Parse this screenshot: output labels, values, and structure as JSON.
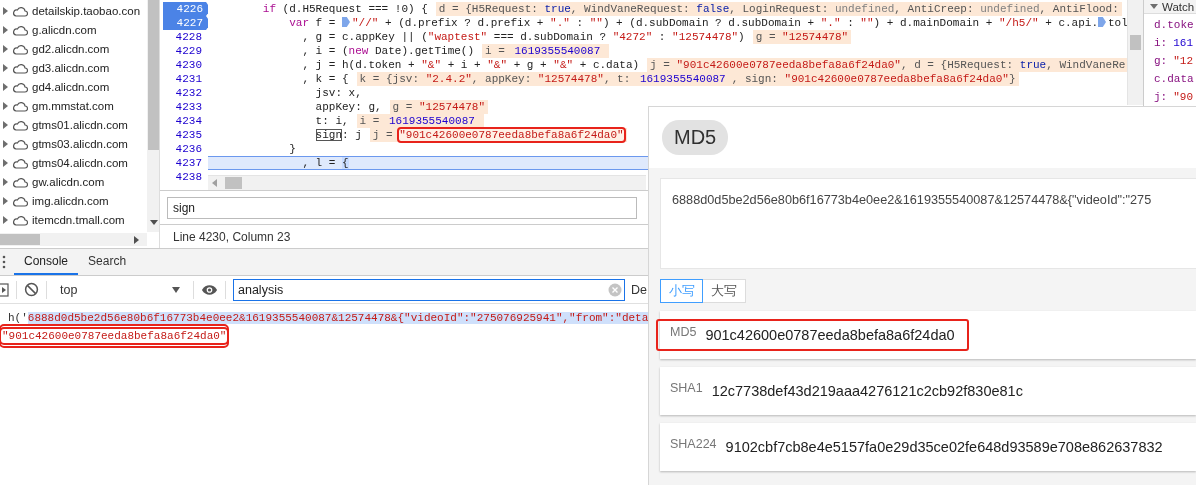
{
  "sidebar": {
    "items": [
      {
        "label": "detailskip.taobao.con",
        "expanded": false
      },
      {
        "label": "g.alicdn.com",
        "expanded": false
      },
      {
        "label": "gd2.alicdn.com",
        "expanded": false
      },
      {
        "label": "gd3.alicdn.com",
        "expanded": false
      },
      {
        "label": "gd4.alicdn.com",
        "expanded": false
      },
      {
        "label": "gm.mmstat.com",
        "expanded": false
      },
      {
        "label": "gtms01.alicdn.com",
        "expanded": false
      },
      {
        "label": "gtms03.alicdn.com",
        "expanded": false
      },
      {
        "label": "gtms04.alicdn.com",
        "expanded": false
      },
      {
        "label": "gw.alicdn.com",
        "expanded": false
      },
      {
        "label": "img.alicdn.com",
        "expanded": false
      },
      {
        "label": "itemcdn.tmall.com",
        "expanded": false
      }
    ]
  },
  "editor": {
    "lines": [
      {
        "number": "4226",
        "breakpoint": true,
        "current": false,
        "code": [
          {
            "text": "if",
            "kind": "kw"
          },
          {
            "text": " (d.H5Request === !0) {",
            "kind": "plain"
          }
        ],
        "inline": [
          {
            "text": "d = {H5Request: ",
            "kind": "plain"
          },
          {
            "text": "true",
            "kind": "bool"
          },
          {
            "text": ", WindVaneRequest: ",
            "kind": "plain"
          },
          {
            "text": "false",
            "kind": "bool"
          },
          {
            "text": ", LoginRequest: ",
            "kind": "plain"
          },
          {
            "text": "undefined",
            "kind": "undef"
          },
          {
            "text": ", AntiCreep: ",
            "kind": "plain"
          },
          {
            "text": "undefined",
            "kind": "undef"
          },
          {
            "text": ", AntiFlood:",
            "kind": "plain"
          }
        ]
      },
      {
        "number": "4227",
        "breakpoint": true,
        "current": false,
        "code": [
          {
            "text": "var",
            "kind": "kw"
          },
          {
            "text": " f = ",
            "kind": "plain"
          },
          {
            "kind": "marker"
          },
          {
            "text": "\"//\"",
            "kind": "str"
          },
          {
            "text": " + (d.prefix ? d.prefix + ",
            "kind": "plain"
          },
          {
            "text": "\".\"",
            "kind": "str"
          },
          {
            "text": " : ",
            "kind": "plain"
          },
          {
            "text": "\"\"",
            "kind": "str"
          },
          {
            "text": ") + (d.subDomain ? d.subDomain + ",
            "kind": "plain"
          },
          {
            "text": "\".\"",
            "kind": "str"
          },
          {
            "text": " : ",
            "kind": "plain"
          },
          {
            "text": "\"\"",
            "kind": "str"
          },
          {
            "text": ") + d.mainDomain + ",
            "kind": "plain"
          },
          {
            "text": "\"/h5/\"",
            "kind": "str"
          },
          {
            "text": " + c.api.",
            "kind": "plain"
          },
          {
            "kind": "marker"
          },
          {
            "text": "tol",
            "kind": "plain"
          }
        ]
      },
      {
        "number": "4228",
        "breakpoint": false,
        "current": false,
        "code": [
          {
            "text": ", g = c.appKey || (",
            "kind": "plain"
          },
          {
            "text": "\"waptest\"",
            "kind": "str"
          },
          {
            "text": " === d.subDomain ? ",
            "kind": "plain"
          },
          {
            "text": "\"4272\"",
            "kind": "str"
          },
          {
            "text": " : ",
            "kind": "plain"
          },
          {
            "text": "\"12574478\"",
            "kind": "str"
          },
          {
            "text": ")",
            "kind": "plain"
          }
        ],
        "inline": [
          {
            "text": "g = ",
            "kind": "plain"
          },
          {
            "text": "\"12574478\"",
            "kind": "str"
          }
        ]
      },
      {
        "number": "4229",
        "breakpoint": false,
        "current": false,
        "code": [
          {
            "text": ", i = (",
            "kind": "plain"
          },
          {
            "text": "new",
            "kind": "kw"
          },
          {
            "text": " Date).getTime()",
            "kind": "plain"
          }
        ],
        "inline": [
          {
            "text": "i = ",
            "kind": "plain"
          },
          {
            "text": "1619355540087",
            "kind": "num"
          }
        ]
      },
      {
        "number": "4230",
        "breakpoint": false,
        "current": false,
        "code": [
          {
            "text": ", j = h(d.token + ",
            "kind": "plain"
          },
          {
            "text": "\"&\"",
            "kind": "str"
          },
          {
            "text": " + i + ",
            "kind": "plain"
          },
          {
            "text": "\"&\"",
            "kind": "str"
          },
          {
            "text": " + g + ",
            "kind": "plain"
          },
          {
            "text": "\"&\"",
            "kind": "str"
          },
          {
            "text": " + c.data)",
            "kind": "plain"
          }
        ],
        "inline": [
          {
            "text": "j = ",
            "kind": "plain"
          },
          {
            "text": "\"901c42600e0787eeda8befa8a6f24da0\"",
            "kind": "str"
          },
          {
            "text": ", d = {H5Request: ",
            "kind": "plain"
          },
          {
            "text": "true",
            "kind": "bool"
          },
          {
            "text": ", WindVaneRe",
            "kind": "plain"
          }
        ]
      },
      {
        "number": "4231",
        "breakpoint": false,
        "current": false,
        "code": [
          {
            "text": ", k = {",
            "kind": "plain"
          }
        ],
        "inline": [
          {
            "text": "k = {jsv: ",
            "kind": "plain"
          },
          {
            "text": "\"2.4.2\"",
            "kind": "str"
          },
          {
            "text": ", appKey: ",
            "kind": "plain"
          },
          {
            "text": "\"12574478\"",
            "kind": "str"
          },
          {
            "text": ", t: ",
            "kind": "plain"
          },
          {
            "text": "1619355540087",
            "kind": "num"
          },
          {
            "text": ", sign: ",
            "kind": "plain"
          },
          {
            "text": "\"901c42600e0787eeda8befa8a6f24da0\"",
            "kind": "str"
          },
          {
            "text": "}",
            "kind": "plain"
          }
        ]
      },
      {
        "number": "4232",
        "breakpoint": false,
        "current": false,
        "code": [
          {
            "text": "jsv: x,",
            "kind": "plain"
          }
        ]
      },
      {
        "number": "4233",
        "breakpoint": false,
        "current": false,
        "code": [
          {
            "text": "appKey: g,",
            "kind": "plain"
          }
        ],
        "inline": [
          {
            "text": "g = ",
            "kind": "plain"
          },
          {
            "text": "\"12574478\"",
            "kind": "str"
          }
        ]
      },
      {
        "number": "4234",
        "breakpoint": false,
        "current": false,
        "code": [
          {
            "text": "t: i,",
            "kind": "plain"
          }
        ],
        "inline": [
          {
            "text": "i = ",
            "kind": "plain"
          },
          {
            "text": "1619355540087",
            "kind": "num"
          }
        ]
      },
      {
        "number": "4235",
        "breakpoint": false,
        "current": false,
        "code": [
          {
            "text": "sign",
            "kind": "match"
          },
          {
            "text": ": j",
            "kind": "plain"
          }
        ],
        "inline": [
          {
            "text": "j = ",
            "kind": "plain"
          },
          {
            "text": "\"901c42600e0787eeda8befa8a6f24da0\"",
            "kind": "marked"
          }
        ]
      },
      {
        "number": "4236",
        "breakpoint": false,
        "current": false,
        "code": [
          {
            "text": "}",
            "kind": "plain"
          }
        ]
      },
      {
        "number": "4237",
        "breakpoint": false,
        "current": true,
        "code": [
          {
            "text": ", l = ",
            "kind": "plain"
          },
          {
            "text": "{",
            "kind": "bracket"
          }
        ]
      },
      {
        "number": "4238",
        "breakpoint": false,
        "current": false
      }
    ]
  },
  "watch": {
    "title": "Watch",
    "expanded": true,
    "items": [
      [
        {
          "text": "d.toke",
          "kind": "name"
        }
      ],
      [
        {
          "text": "i:",
          "kind": "name"
        },
        {
          "text": "161",
          "kind": "num"
        }
      ],
      [
        {
          "text": "g:",
          "kind": "name"
        },
        {
          "text": "\"12",
          "kind": "str"
        }
      ],
      [
        {
          "text": "c.data",
          "kind": "name"
        }
      ],
      [
        {
          "text": "j:",
          "kind": "name"
        },
        {
          "text": "\"90",
          "kind": "str"
        }
      ]
    ]
  },
  "search": {
    "value": "sign"
  },
  "status_bar": "Line 4230, Column 23",
  "console": {
    "tabs": [
      {
        "label": "Console",
        "selected": true
      },
      {
        "label": "Search",
        "selected": false
      }
    ],
    "context": "top",
    "filter": "analysis",
    "levels": "De",
    "output": [
      {
        "highlighted": false,
        "tokens": [
          {
            "text": "h('",
            "kind": "plain"
          },
          {
            "text": "6888d0d5be2d56e80b6f16773b4e0ee2&1619355540087&12574478&{\"videoId\":\"275076925941\",\"from\":\"deta",
            "kind": "selected"
          }
        ]
      },
      {
        "highlighted": true,
        "tokens": [
          {
            "text": "\"901c42600e0787eeda8befa8a6f24da0\"",
            "kind": "str"
          }
        ]
      }
    ]
  },
  "hash_tool": {
    "title": "MD5",
    "input": "6888d0d5be2d56e80b6f16773b4e0ee2&1619355540087&12574478&{\"videoId\":\"275",
    "cases": [
      {
        "label": "小写",
        "selected": true
      },
      {
        "label": "大写",
        "selected": false
      }
    ],
    "results": [
      {
        "algorithm": "MD5",
        "value": "901c42600e0787eeda8befa8a6f24da0",
        "highlighted": true
      },
      {
        "algorithm": "SHA1",
        "value": "12c7738def43d219aaa4276121c2cb92f830e81c",
        "highlighted": false
      },
      {
        "algorithm": "SHA224",
        "value": "9102cbf7cb8e4e5157fa0e29d35ce02fe648d93589e708e862637832",
        "highlighted": false
      }
    ]
  }
}
